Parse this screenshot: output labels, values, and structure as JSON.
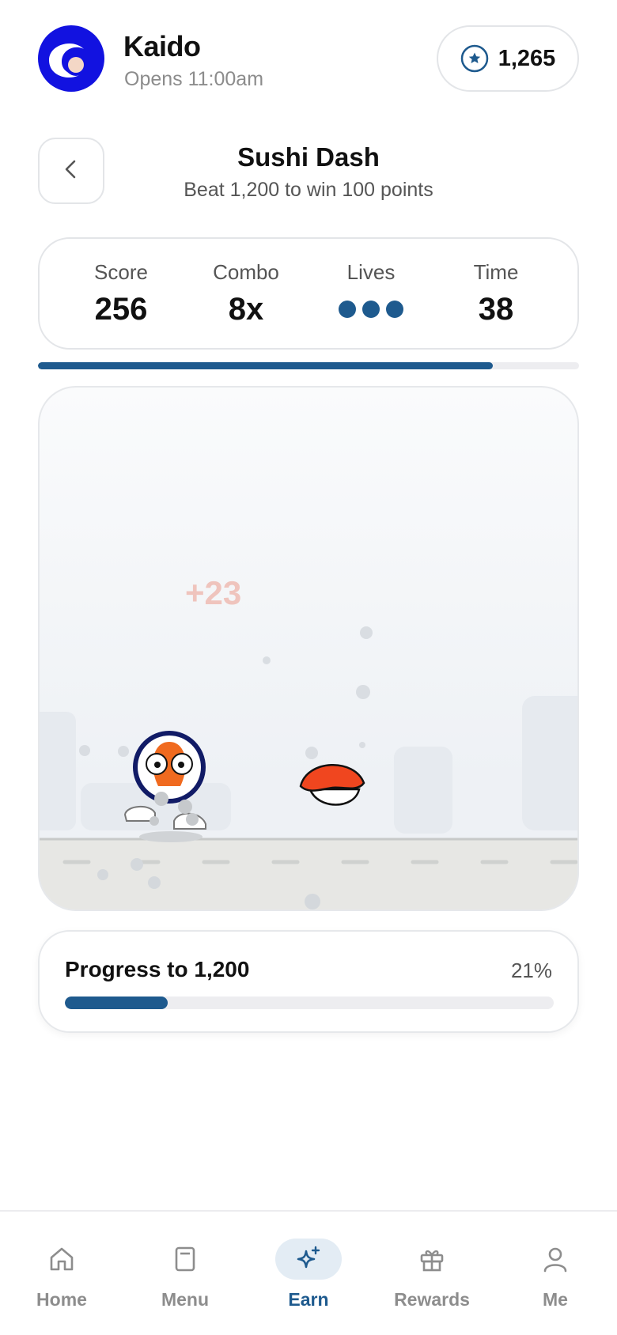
{
  "header": {
    "store_name": "Kaido",
    "store_hours": "Opens 11:00am",
    "points": "1,265",
    "logo_icon": "kaido-wave-logo",
    "points_icon": "star-circle-icon"
  },
  "game": {
    "title": "Sushi Dash",
    "subtitle": "Beat 1,200 to win 100 points",
    "stats": {
      "score_label": "Score",
      "score_value": "256",
      "combo_label": "Combo",
      "combo_value": "8x",
      "lives_label": "Lives",
      "lives_count": 3,
      "time_label": "Time",
      "time_value": "38"
    },
    "time_remaining_fraction": 0.84,
    "score_popup": "+23"
  },
  "progress": {
    "label": "Progress to 1,200",
    "percent_label": "21%",
    "fraction": 0.21
  },
  "tabs": [
    {
      "label": "Home",
      "icon": "home-icon",
      "active": false
    },
    {
      "label": "Menu",
      "icon": "menu-book-icon",
      "active": false
    },
    {
      "label": "Earn",
      "icon": "sparkle-icon",
      "active": true
    },
    {
      "label": "Rewards",
      "icon": "gift-icon",
      "active": false
    },
    {
      "label": "Me",
      "icon": "person-icon",
      "active": false
    }
  ],
  "colors": {
    "accent": "#1e5a8e",
    "logo_blue": "#1212e0",
    "salmon": "#f06a1f",
    "popup": "#efc4bd"
  }
}
